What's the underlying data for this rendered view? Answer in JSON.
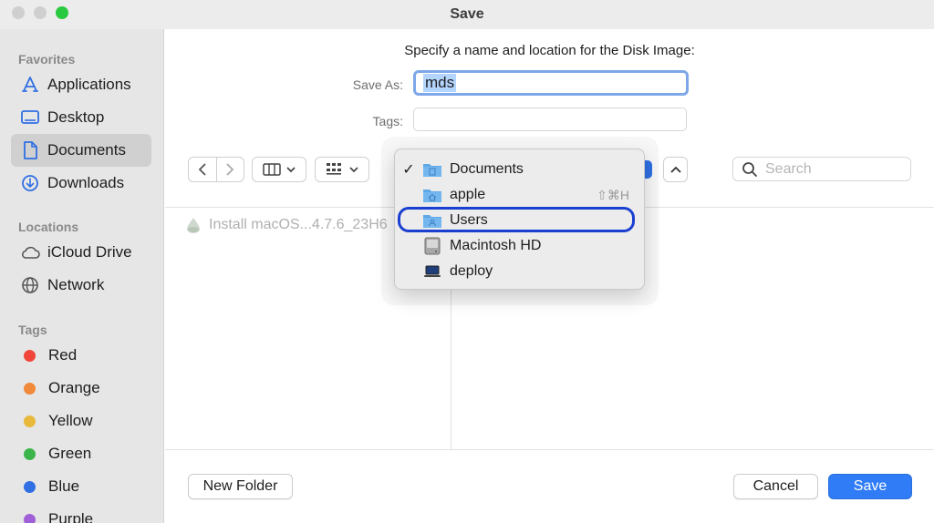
{
  "window": {
    "title": "Save"
  },
  "sidebar": {
    "favorites_header": "Favorites",
    "favorites": [
      {
        "label": "Applications",
        "icon": "applications-icon"
      },
      {
        "label": "Desktop",
        "icon": "desktop-icon"
      },
      {
        "label": "Documents",
        "icon": "document-icon",
        "selected": true
      },
      {
        "label": "Downloads",
        "icon": "downloads-icon"
      }
    ],
    "locations_header": "Locations",
    "locations": [
      {
        "label": "iCloud Drive",
        "icon": "cloud-icon"
      },
      {
        "label": "Network",
        "icon": "globe-icon"
      }
    ],
    "tags_header": "Tags",
    "tags": [
      {
        "label": "Red",
        "color": "#f0463a"
      },
      {
        "label": "Orange",
        "color": "#f0893a"
      },
      {
        "label": "Yellow",
        "color": "#e8b93a"
      },
      {
        "label": "Green",
        "color": "#3bb54a"
      },
      {
        "label": "Blue",
        "color": "#2f6fe3"
      },
      {
        "label": "Purple",
        "color": "#a05fd6"
      }
    ]
  },
  "dialog": {
    "prompt": "Specify a name and location for the Disk Image:",
    "save_as_label": "Save As:",
    "save_as_value": "mds",
    "tags_label": "Tags:",
    "search_placeholder": "Search",
    "file_item": "Install macOS...4.7.6_23H6",
    "new_folder_label": "New Folder",
    "cancel_label": "Cancel",
    "save_label": "Save"
  },
  "location_menu": {
    "items": [
      {
        "label": "Documents",
        "checked": true,
        "icon": "documents-folder-icon"
      },
      {
        "label": "apple",
        "shortcut": "⇧⌘H",
        "icon": "home-folder-icon"
      },
      {
        "label": "Users",
        "icon": "users-folder-icon",
        "highlighted": true
      },
      {
        "label": "Macintosh HD",
        "icon": "hard-drive-icon"
      },
      {
        "label": "deploy",
        "icon": "laptop-icon"
      }
    ]
  },
  "colors": {
    "accent": "#2f7cf6",
    "focus_ring": "#1a3fd1",
    "folder": "#5ea8e6"
  }
}
